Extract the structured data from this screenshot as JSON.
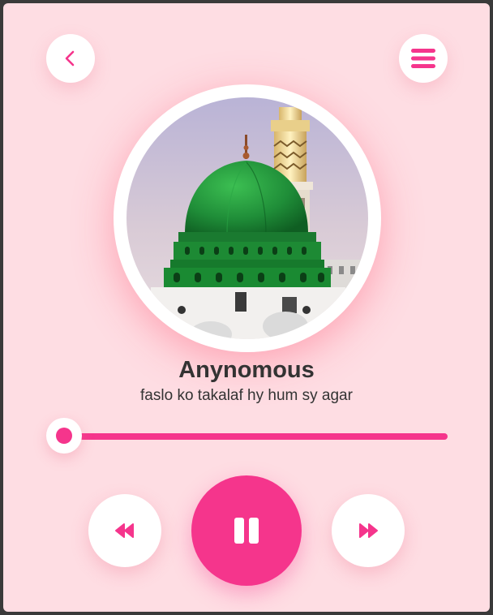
{
  "colors": {
    "background": "#fedde3",
    "accent": "#f5358c",
    "button": "#ffffff",
    "text": "#333333"
  },
  "header": {
    "back_icon": "chevron-left-icon",
    "menu_icon": "hamburger-menu-icon"
  },
  "now_playing": {
    "artist": "Anynomous",
    "title": "faslo ko takalaf hy hum sy agar",
    "progress": 0
  },
  "controls": {
    "prev_icon": "rewind-icon",
    "play_pause_icon": "pause-icon",
    "next_icon": "fast-forward-icon"
  }
}
